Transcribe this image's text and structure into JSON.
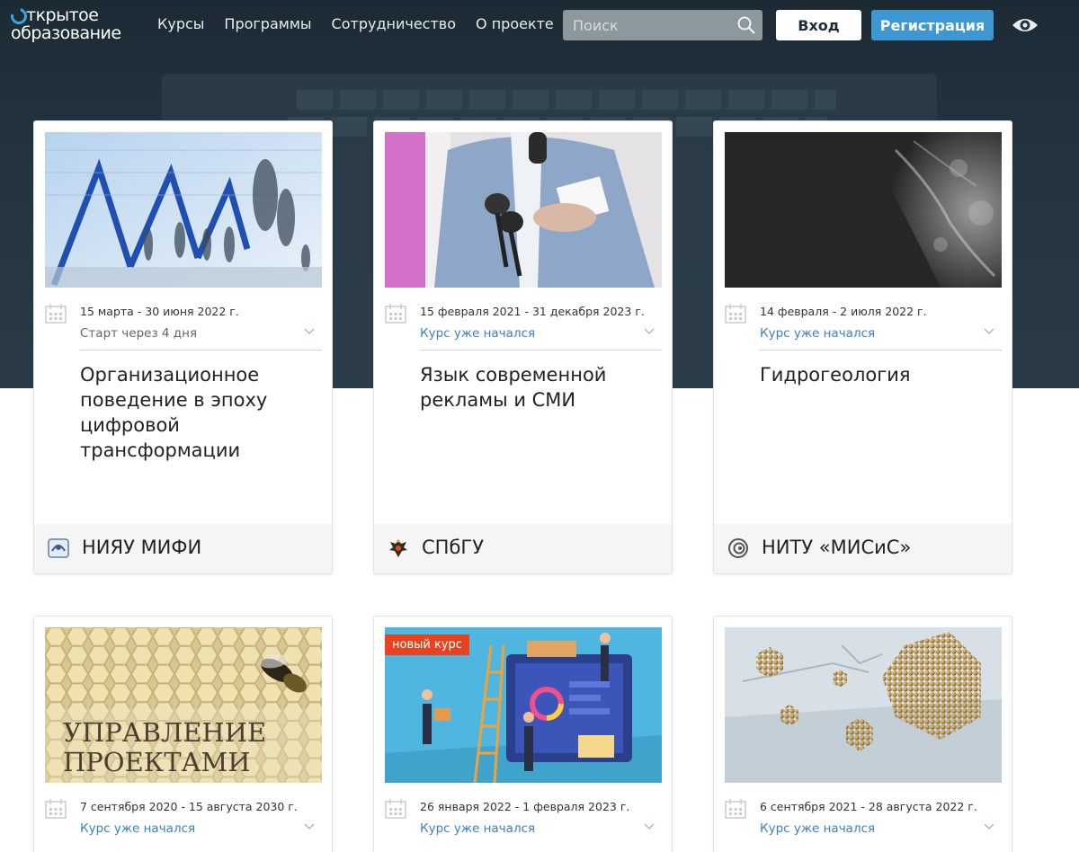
{
  "header": {
    "logo_line1": "ткрытое",
    "logo_line2": "образование",
    "nav": [
      "Курсы",
      "Программы",
      "Сотрудничество",
      "О проекте"
    ],
    "search_placeholder": "Поиск",
    "login_label": "Вход",
    "register_label": "Регистрация"
  },
  "colors": {
    "accent": "#3d97d3",
    "hero_bg": "#24343f",
    "status_blue": "#3d7fc0",
    "badge_red": "#e8421e"
  },
  "cards": [
    {
      "dates": "15 марта - 30 июня 2022 г.",
      "status": "Старт через 4 дня",
      "status_type": "gray",
      "title": "Организационное поведение в эпоху цифровой трансформации",
      "university": "НИЯУ МИФИ",
      "image": "people-walking-building"
    },
    {
      "dates": "15 февраля 2021 - 31 декабря 2023 г.",
      "status": "Курс уже начался",
      "status_type": "blue",
      "title": "Язык современной рекламы и СМИ",
      "university": "СПбГУ",
      "image": "journalist-microphones"
    },
    {
      "dates": "14 февраля - 2 июля 2022 г.",
      "status": "Курс уже начался",
      "status_type": "blue",
      "title": "Гидрогеология",
      "university": "НИТУ «МИСиС»",
      "image": "satellite-earth"
    },
    {
      "dates": "7 сентября 2020 - 15 августа 2030 г.",
      "status": "Курс уже начался",
      "status_type": "blue",
      "image_text_line1": "УПРАВЛЕНИЕ",
      "image_text_line2": "ПРОЕКТАМИ",
      "image": "honeycomb-bee"
    },
    {
      "dates": "26 января 2022 - 1 февраля 2023 г.",
      "status": "Курс уже начался",
      "status_type": "blue",
      "badge": "новый курс",
      "image": "isometric-people-screen"
    },
    {
      "dates": "6 сентября 2021 - 28 августа 2022 г.",
      "status": "Курс уже начался",
      "status_type": "blue",
      "image": "nanoparticle-clusters"
    }
  ]
}
